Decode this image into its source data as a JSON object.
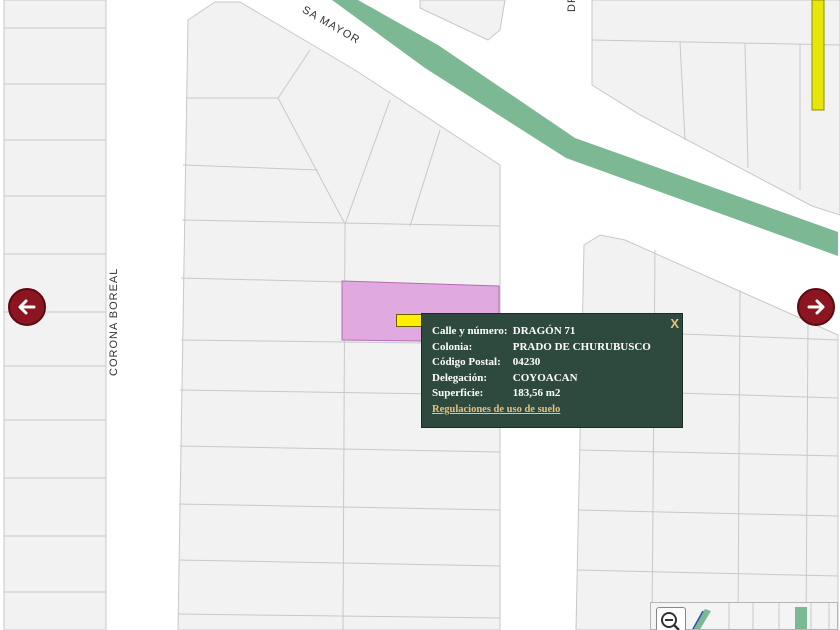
{
  "streets": {
    "corona_boreal": "CORONA BOREAL",
    "osa_mayor": "SA MAYOR",
    "dragon_partial": "DR"
  },
  "nav": {
    "prev_icon": "arrow-left-icon",
    "next_icon": "arrow-right-icon"
  },
  "popup": {
    "close_label": "X",
    "calle_label": "Calle y número:",
    "calle_value": "DRAGÓN 71",
    "colonia_label": "Colonia:",
    "colonia_value": "PRADO DE CHURUBUSCO",
    "cp_label": "Código Postal:",
    "cp_value": "04230",
    "delegacion_label": "Delegación:",
    "delegacion_value": "COYOACAN",
    "superficie_label": "Superficie:",
    "superficie_value": "183,56 m2",
    "link_label": "Regulaciones de uso de suelo"
  },
  "colors": {
    "parcel_fill": "#f2f2f2",
    "parcel_stroke": "#c8c8c8",
    "selected_parcel": "#e0a9e0",
    "median": "#7db894",
    "popup_bg": "#2e4a3f",
    "link": "#e8c07a",
    "arrow": "#8b1520"
  },
  "icons": {
    "zoom_out": "zoom-out-icon",
    "marker": "location-marker-icon"
  }
}
